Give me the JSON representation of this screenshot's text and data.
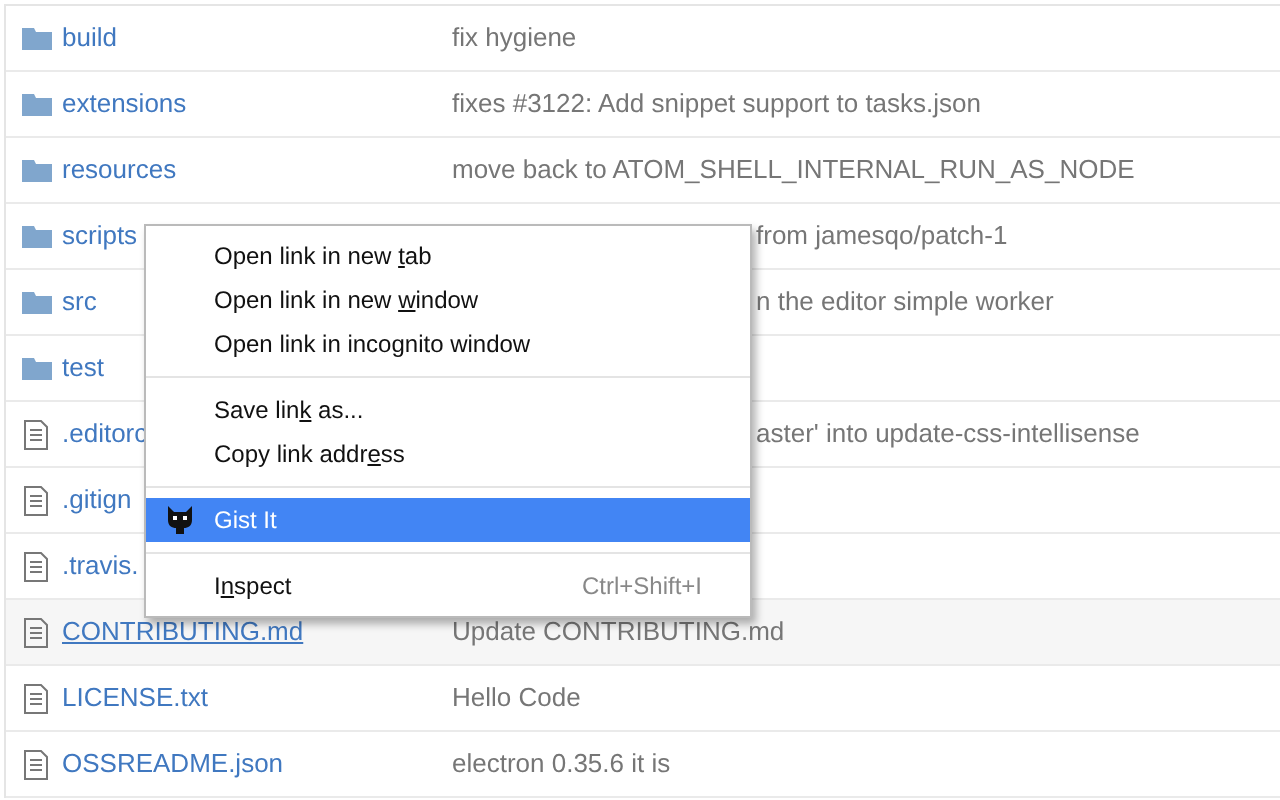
{
  "files": [
    {
      "kind": "folder",
      "name": "build",
      "message": "fix hygiene",
      "hovered": false
    },
    {
      "kind": "folder",
      "name": "extensions",
      "message": "fixes #3122: Add snippet support to tasks.json",
      "hovered": false
    },
    {
      "kind": "folder",
      "name": "resources",
      "message": "move back to ATOM_SHELL_INTERNAL_RUN_AS_NODE",
      "hovered": false
    },
    {
      "kind": "folder",
      "name": "scripts",
      "message": "from jamesqo/patch-1",
      "hovered": false
    },
    {
      "kind": "folder",
      "name": "src",
      "message": "n the editor simple worker",
      "hovered": false
    },
    {
      "kind": "folder",
      "name": "test",
      "hovered": false
    },
    {
      "kind": "file",
      "name": ".editorc",
      "message": "aster' into update-css-intellisense",
      "hovered": false
    },
    {
      "kind": "file",
      "name": ".gitign",
      "hovered": false
    },
    {
      "kind": "file",
      "name": ".travis.",
      "hovered": false
    },
    {
      "kind": "file",
      "name": "CONTRIBUTING.md",
      "message": "Update CONTRIBUTING.md",
      "hovered": true
    },
    {
      "kind": "file",
      "name": "LICENSE.txt",
      "message": "Hello Code",
      "hovered": false
    },
    {
      "kind": "file",
      "name": "OSSREADME.json",
      "message": "electron 0.35.6 it is",
      "hovered": false
    }
  ],
  "context_menu": [
    {
      "kind": "item",
      "label_parts": [
        "Open link in new ",
        "t",
        "ab"
      ],
      "selected": false
    },
    {
      "kind": "item",
      "label_parts": [
        "Open link in new ",
        "w",
        "indow"
      ],
      "selected": false
    },
    {
      "kind": "item",
      "label_parts": [
        "Open link in incognito window"
      ],
      "selected": false
    },
    {
      "kind": "separator"
    },
    {
      "kind": "item",
      "label_parts": [
        "Save lin",
        "k",
        " as..."
      ],
      "selected": false
    },
    {
      "kind": "item",
      "label_parts": [
        "Copy link addr",
        "e",
        "ss"
      ],
      "selected": false
    },
    {
      "kind": "separator"
    },
    {
      "kind": "extension",
      "label_parts": [
        "Gist It"
      ],
      "selected": true
    },
    {
      "kind": "separator"
    },
    {
      "kind": "item",
      "label_parts": [
        "I",
        "n",
        "spect"
      ],
      "shortcut": "Ctrl+Shift+I",
      "selected": false
    }
  ]
}
